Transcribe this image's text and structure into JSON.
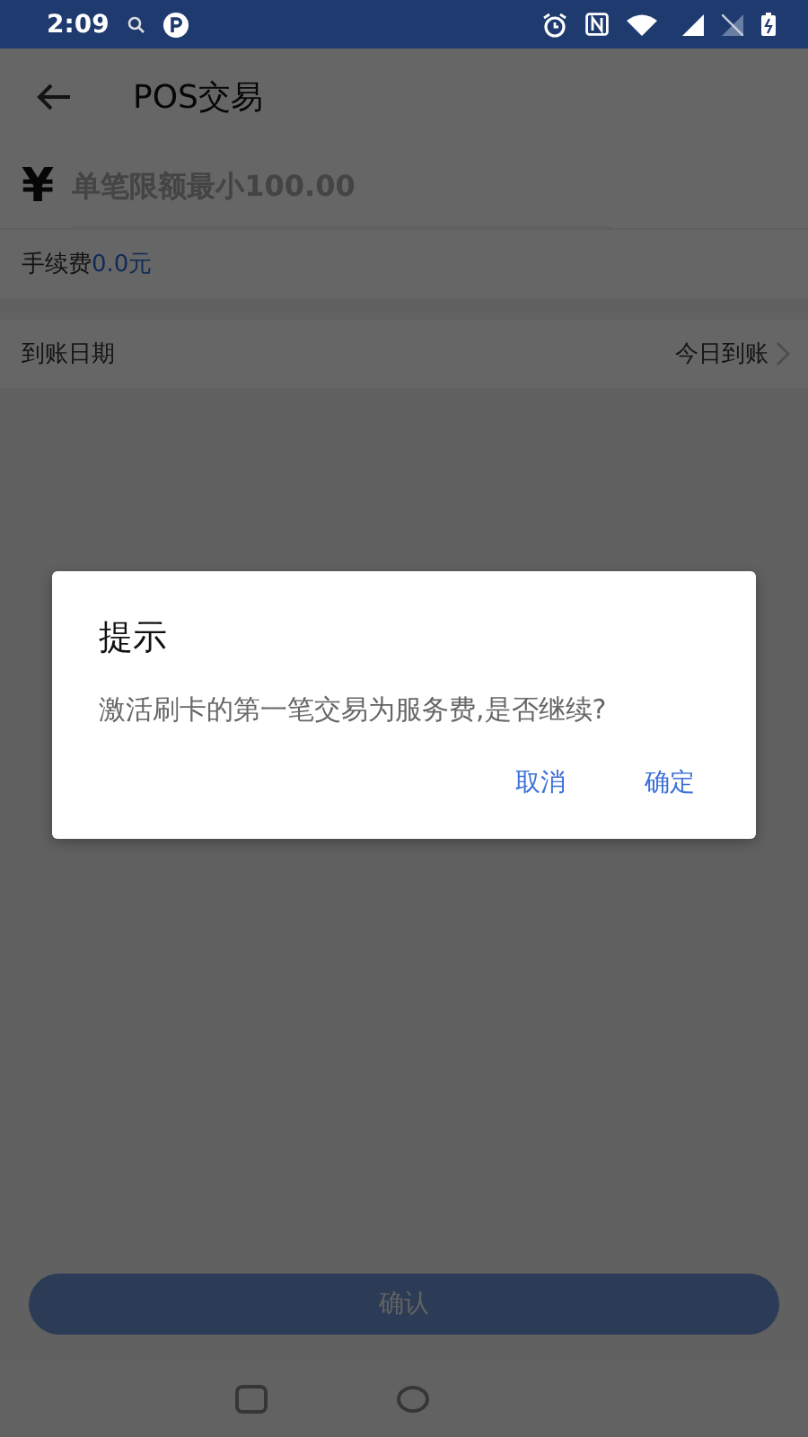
{
  "status_bar": {
    "time": "2:09"
  },
  "app_bar": {
    "title": "POS交易"
  },
  "amount": {
    "currency_symbol": "¥",
    "placeholder": "单笔限额最小100.00"
  },
  "fee": {
    "label": "手续费",
    "value": "0.0元"
  },
  "settle_date": {
    "label": "到账日期",
    "value": "今日到账"
  },
  "confirm_button": "确认",
  "dialog": {
    "title": "提示",
    "message": "激活刷卡的第一笔交易为服务费,是否继续?",
    "buttons": [
      "取消",
      "确定"
    ]
  }
}
